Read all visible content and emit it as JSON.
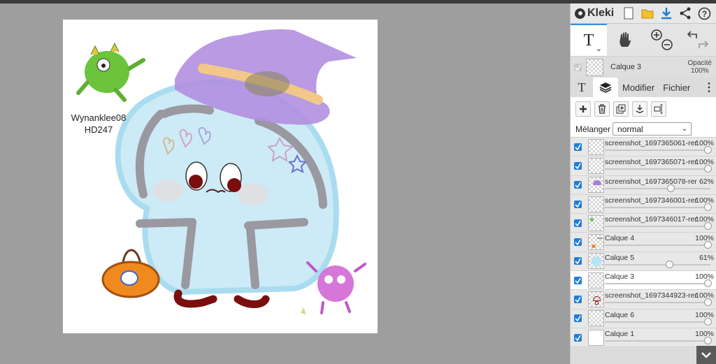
{
  "app": {
    "name": "Kleki",
    "accent_color": "#1f7ed6"
  },
  "header": {
    "icons": [
      "new-page-icon",
      "open-folder-icon",
      "download-icon",
      "share-icon",
      "help-icon"
    ]
  },
  "tools": {
    "text_tool": "T",
    "text_tool_dropdown": "⌄",
    "hand_tool": "hand-icon",
    "zoom": [
      "zoom-in-icon",
      "zoom-out-icon"
    ],
    "history": [
      "undo-icon",
      "redo-icon"
    ]
  },
  "current_layer": {
    "name": "Calque 3",
    "opacity_label": "Opacité",
    "opacity_value": "100%"
  },
  "tabs": {
    "text": "T",
    "layers": "layers-icon",
    "edit": "Modifier",
    "file": "Fichier",
    "more": "⋮"
  },
  "layer_actions": [
    "add-layer-icon",
    "delete-layer-icon",
    "duplicate-layer-icon",
    "merge-down-icon",
    "rename-layer-icon"
  ],
  "blend": {
    "label": "Mélanger",
    "value": "normal",
    "caret": "⌄"
  },
  "layers": [
    {
      "name": "screenshot_1697365061-rem",
      "opacity": "100%",
      "level": 1.0,
      "active": false,
      "thumb": "transparent"
    },
    {
      "name": "screenshot_1697365071-rem",
      "opacity": "100%",
      "level": 1.0,
      "active": false,
      "thumb": "transparent"
    },
    {
      "name": "screenshot_1697365078-rem",
      "opacity": "62%",
      "level": 0.62,
      "active": false,
      "thumb": "purple-hat"
    },
    {
      "name": "screenshot_1697346001-rem",
      "opacity": "100%",
      "level": 1.0,
      "active": false,
      "thumb": "transparent"
    },
    {
      "name": "screenshot_1697346017-rem",
      "opacity": "100%",
      "level": 1.0,
      "active": false,
      "thumb": "green-dot"
    },
    {
      "name": "Calque 4",
      "opacity": "100%",
      "level": 1.0,
      "active": false,
      "thumb": "sketch"
    },
    {
      "name": "Calque 5",
      "opacity": "61%",
      "level": 0.61,
      "active": false,
      "thumb": "blue-ghost"
    },
    {
      "name": "Calque 3",
      "opacity": "100%",
      "level": 1.0,
      "active": true,
      "thumb": "transparent"
    },
    {
      "name": "screenshot_1697344923-rem",
      "opacity": "100%",
      "level": 1.0,
      "active": false,
      "thumb": "mushroom"
    },
    {
      "name": "Calque 6",
      "opacity": "100%",
      "level": 1.0,
      "active": false,
      "thumb": "transparent"
    },
    {
      "name": "Calque 1",
      "opacity": "100%",
      "level": 1.0,
      "active": false,
      "thumb": "white"
    }
  ],
  "canvas": {
    "watermark_line1": "Wynanklee08",
    "watermark_line2": "HD247"
  },
  "collapse_button": "chevron-down-icon"
}
